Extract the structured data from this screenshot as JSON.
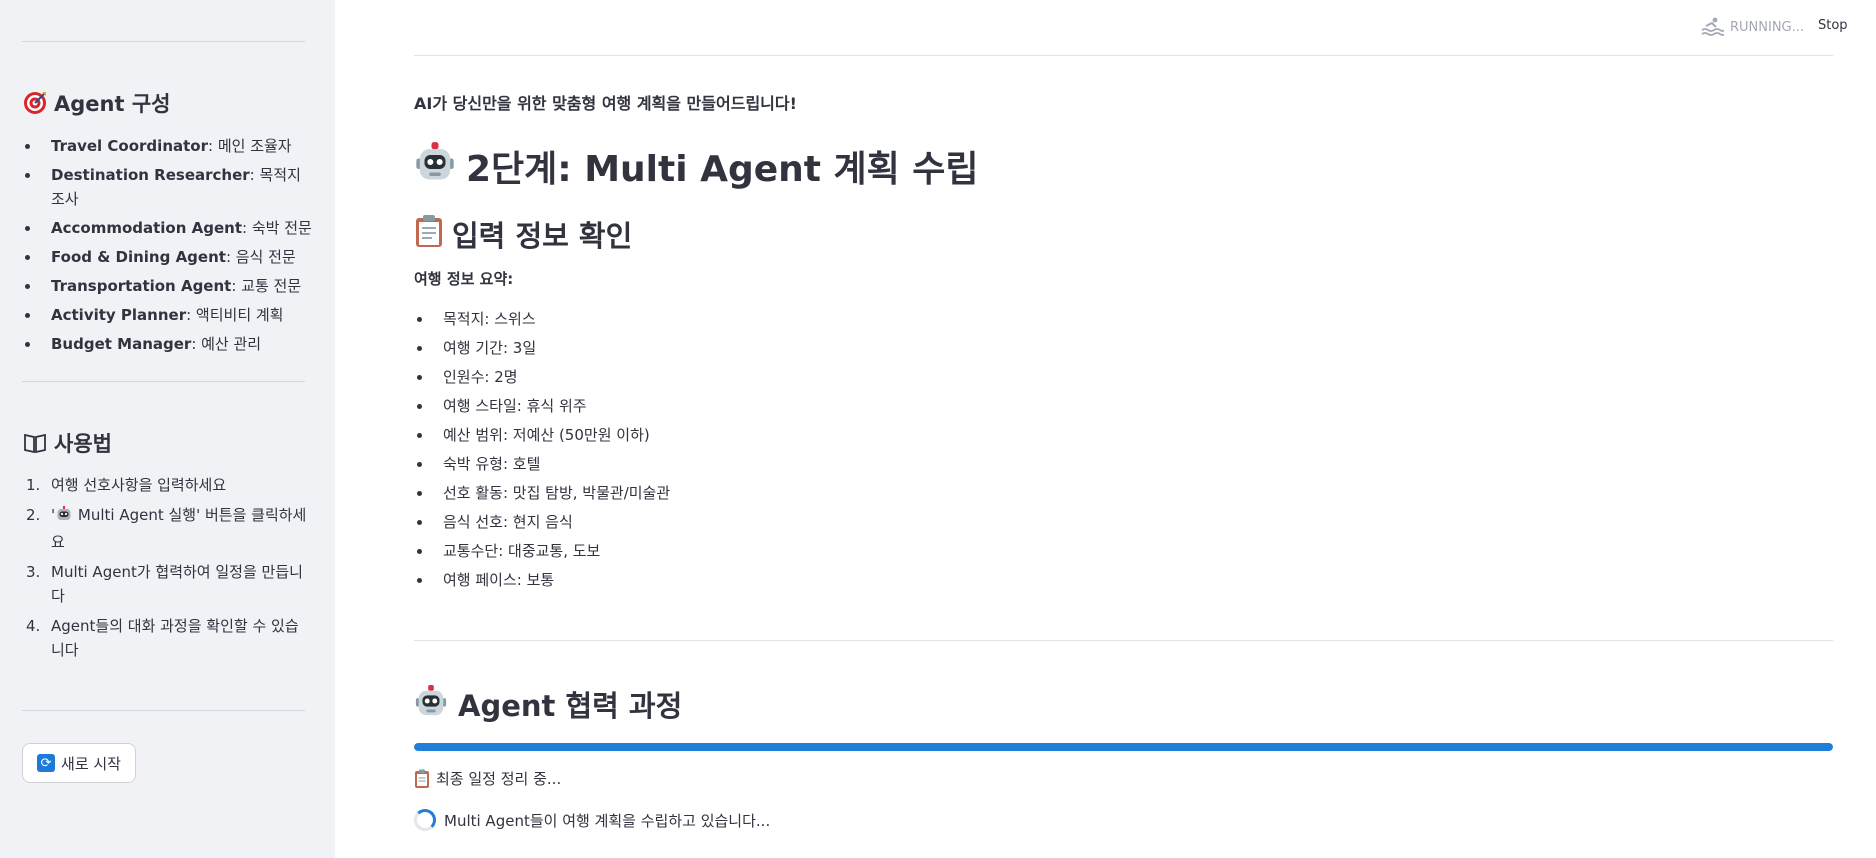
{
  "sidebar": {
    "agents_heading": "Agent 구성",
    "agents": [
      {
        "name": "Travel Coordinator",
        "role": ": 메인 조율자"
      },
      {
        "name": "Destination Researcher",
        "role": ": 목적지 조사"
      },
      {
        "name": "Accommodation Agent",
        "role": ": 숙박 전문"
      },
      {
        "name": "Food & Dining Agent",
        "role": ": 음식 전문"
      },
      {
        "name": "Transportation Agent",
        "role": ": 교통 전문"
      },
      {
        "name": "Activity Planner",
        "role": ": 액티비티 계획"
      },
      {
        "name": "Budget Manager",
        "role": ": 예산 관리"
      }
    ],
    "usage_heading": "사용법",
    "usage_steps": [
      {
        "num": "1.",
        "text": "여행 선호사항을 입력하세요"
      },
      {
        "num": "2.",
        "text_pre": "'",
        "text": " Multi Agent 실행' 버튼을 클릭하세요"
      },
      {
        "num": "3.",
        "text": "Multi Agent가 협력하여 일정을 만듭니다"
      },
      {
        "num": "4.",
        "text": "Agent들의 대화 과정을 확인할 수 있습니다"
      }
    ],
    "restart_button": "새로 시작"
  },
  "topbar": {
    "status": "RUNNING...",
    "stop": "Stop"
  },
  "main": {
    "subtitle": "AI가 당신만을 위한 맞춤형 여행 계획을 만들어드립니다!",
    "title": "2단계: Multi Agent 계획 수립",
    "input_heading": "입력 정보 확인",
    "summary_label": "여행 정보 요약:",
    "summary_items": [
      "목적지: 스위스",
      "여행 기간: 3일",
      "인원수: 2명",
      "여행 스타일: 휴식 위주",
      "예산 범위: 저예산 (50만원 이하)",
      "숙박 유형: 호텔",
      "선호 활동: 맛집 탐방, 박물관/미술관",
      "음식 선호: 현지 음식",
      "교통수단: 대중교통, 도보",
      "여행 페이스: 보통"
    ],
    "collab_heading": "Agent 협력 과정",
    "progress_percent": 100,
    "step_status": "최종 일정 정리 중...",
    "spinner_text": "Multi Agent들이 여행 계획을 수립하고 있습니다..."
  },
  "colors": {
    "sidebar_bg": "#f0f2f6",
    "accent": "#1f7fd6",
    "text": "#31333f"
  }
}
